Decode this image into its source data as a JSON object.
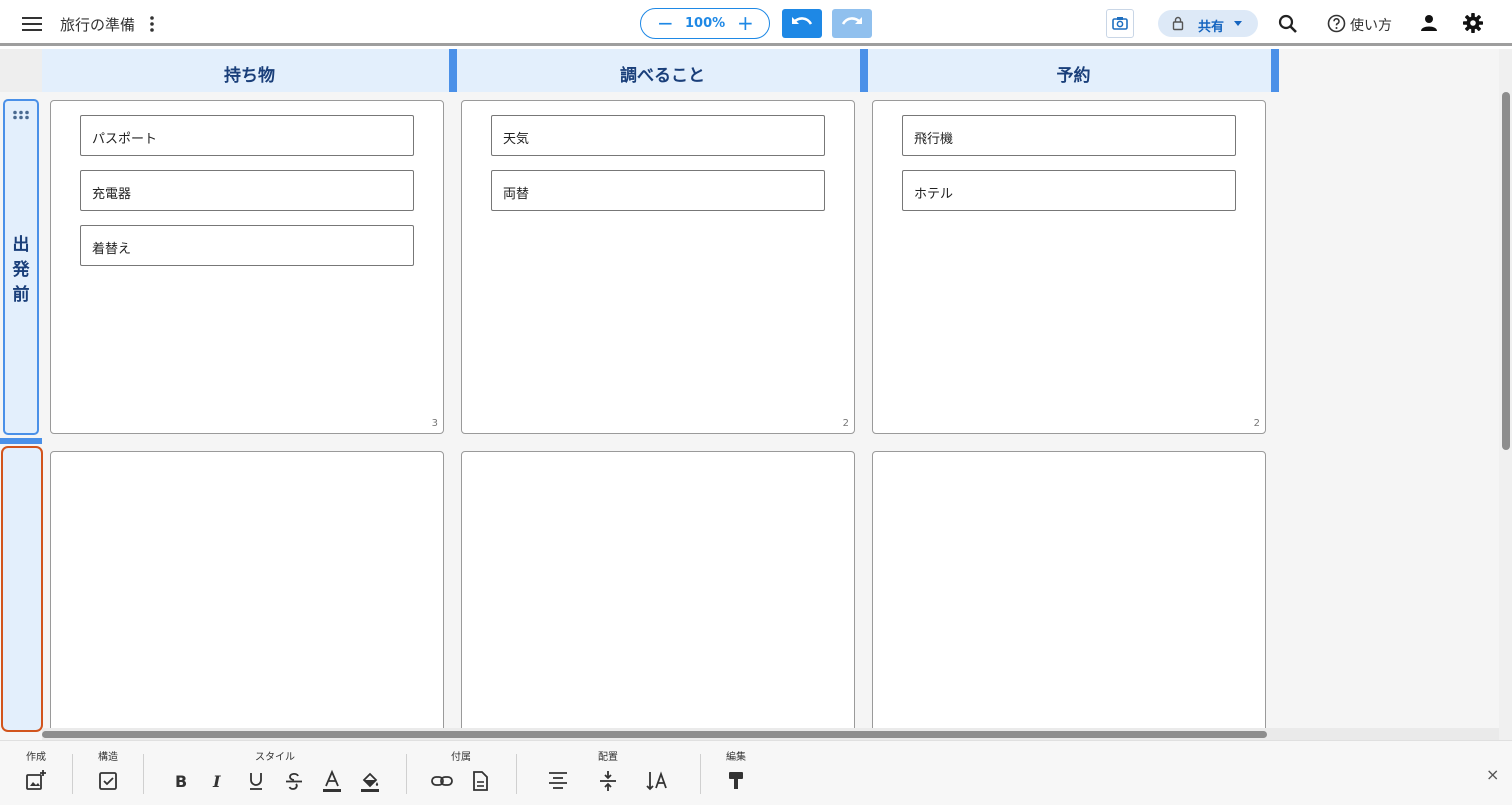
{
  "header": {
    "document_title": "旅行の準備",
    "zoom_value": "100%",
    "zoom_minus": "−",
    "zoom_plus": "+",
    "share_label": "共有",
    "help_label": "使い方"
  },
  "board": {
    "columns": [
      {
        "title": "持ち物"
      },
      {
        "title": "調べること"
      },
      {
        "title": "予約"
      }
    ],
    "rows": [
      {
        "title": "出\n発\n前",
        "title_lines": [
          "出",
          "発",
          "前"
        ]
      },
      {
        "title": ""
      }
    ],
    "cells": [
      {
        "cards": [
          "パスポート",
          "充電器",
          "着替え"
        ],
        "count": "3"
      },
      {
        "cards": [
          "天気",
          "両替"
        ],
        "count": "2"
      },
      {
        "cards": [
          "飛行機",
          "ホテル"
        ],
        "count": "2"
      }
    ]
  },
  "toolbar": {
    "groups": {
      "create": "作成",
      "structure": "構造",
      "style": "スタイル",
      "attach": "付属",
      "arrange": "配置",
      "edit": "編集"
    },
    "close": "×"
  },
  "colors": {
    "accent": "#1e88e5",
    "header_bg": "#e3effc",
    "header_text": "#1a3f7a",
    "row_selected_border": "#d2541c"
  }
}
